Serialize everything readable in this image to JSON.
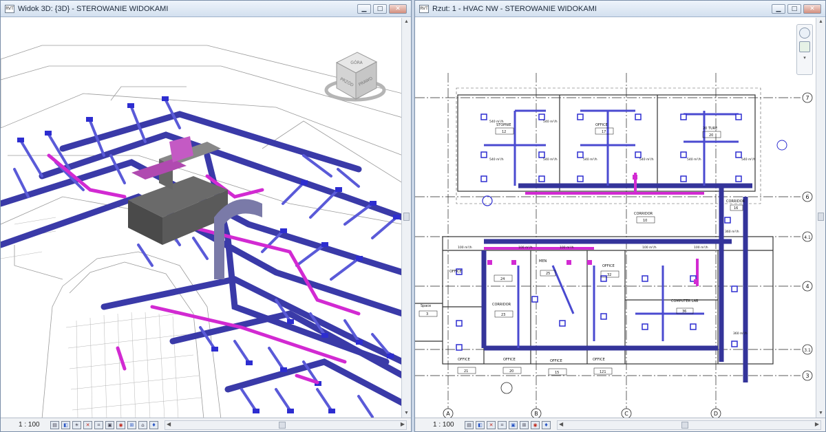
{
  "left_window": {
    "title": "Widok 3D: {3D} - STEROWANIE WIDOKAMI",
    "app_icon": "RVT",
    "minimize_icon": "minimize-icon",
    "maximize_icon": "maximize-icon",
    "close_icon": "close-icon",
    "viewcube": {
      "top_face": "GÓRA",
      "front_face": "PRZÓD",
      "side_face": "PRAWO"
    },
    "scale": "1 : 100",
    "view_controls": [
      "detail-level-icon",
      "visual-style-icon",
      "sun-path-icon",
      "shadows-icon",
      "crop-view-icon",
      "show-crop-icon",
      "temporary-hide-icon",
      "reveal-hidden-icon",
      "3d-lock-icon",
      "analysis-icon"
    ]
  },
  "right_window": {
    "title": "Rzut: 1 - HVAC NW - STEROWANIE WIDOKAMI",
    "app_icon": "RVT",
    "scale": "1 : 100",
    "view_controls": [
      "detail-level-icon",
      "visual-style-icon",
      "sun-path-icon",
      "shadows-icon",
      "crop-view-icon",
      "show-crop-icon",
      "temporary-hide-icon",
      "analysis-icon"
    ],
    "grid_columns": [
      "A",
      "B",
      "C",
      "D"
    ],
    "grid_rows": [
      "7",
      "6",
      "4.1",
      "4",
      "3.1",
      "3"
    ],
    "rooms": [
      {
        "name": "STOPNIE",
        "number": "12"
      },
      {
        "name": "OFFICE",
        "number": "17"
      },
      {
        "name": "20 TURE",
        "number": "20"
      },
      {
        "name": "CORRIDOR",
        "number": "10"
      },
      {
        "name": "CORRIDOR",
        "number": "16"
      },
      {
        "name": "OFFICE",
        "number": "24"
      },
      {
        "name": "MEN",
        "number": "25"
      },
      {
        "name": "OFFICE",
        "number": "32"
      },
      {
        "name": "CORRIDOR",
        "number": "23"
      },
      {
        "name": "COMPUTER LAB",
        "number": "36"
      },
      {
        "name": "OFFICE",
        "number": "21"
      },
      {
        "name": "OFFICE",
        "number": "20"
      },
      {
        "name": "OFFICE",
        "number": "15"
      },
      {
        "name": "OFFICE",
        "number": "121"
      },
      {
        "name": "Space",
        "number": "3"
      }
    ],
    "diffuser_tags": [
      "115",
      "116",
      "117",
      "118",
      "111",
      "112",
      "113",
      "20",
      "21",
      "22",
      "23",
      "24",
      "76",
      "78",
      "79",
      "80",
      "81",
      "77",
      "44",
      "37",
      "38",
      "39",
      "40",
      "42",
      "44",
      "45",
      "46",
      "47",
      "48",
      "51",
      "72",
      "73",
      "74",
      "22"
    ],
    "flow_label": "540 m³/h",
    "flow_label_small": "360 m³/h",
    "airflow_small": "100 m³/h"
  }
}
